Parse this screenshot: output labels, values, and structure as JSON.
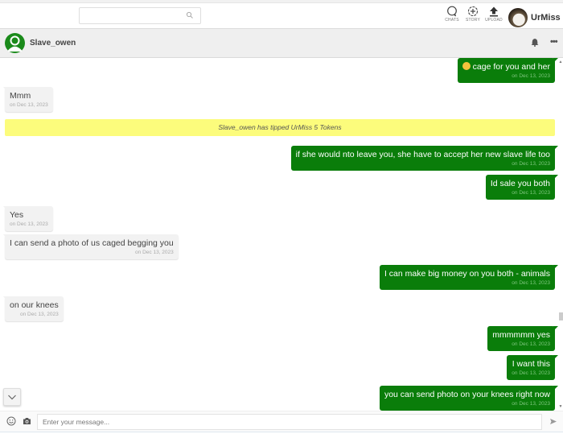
{
  "topbar": {
    "search": {
      "value": "",
      "placeholder": ""
    },
    "nav": [
      {
        "icon": "chat-bubble-icon",
        "label": "CHATS"
      },
      {
        "icon": "add-story-icon",
        "label": "STORY"
      },
      {
        "icon": "upload-icon",
        "label": "UPLOAD"
      }
    ],
    "user": {
      "name": "UrMiss",
      "caret": "▾"
    }
  },
  "chat_header": {
    "contact_name": "Slave_owen",
    "more_label": "•••"
  },
  "colors": {
    "outgoing_bubble": "#0a7d0a",
    "incoming_bubble": "#f2f2f2",
    "tip_banner": "#fcfc7c",
    "avatar_green": "#1a8a1a"
  },
  "messages": [
    {
      "direction": "out",
      "emoji": true,
      "text": "cage for you and her",
      "time": "on Dec 13, 2023"
    },
    {
      "direction": "in",
      "text": "Mmm",
      "time": "on Dec 13, 2023"
    },
    {
      "direction": "system",
      "text": "Slave_owen has tipped UrMiss 5 Tokens"
    },
    {
      "direction": "out",
      "text": "if she would nto leave you, she have to accept her new slave life too",
      "time": "on Dec 13, 2023"
    },
    {
      "direction": "out",
      "text": "Id sale you both",
      "time": "on Dec 13, 2023"
    },
    {
      "direction": "in",
      "text": "Yes",
      "time": "on Dec 13, 2023"
    },
    {
      "direction": "in",
      "text": "I can send a photo of us caged begging you",
      "time": "on Dec 13, 2023"
    },
    {
      "direction": "out",
      "text": "I can make big money on you both - animals",
      "time": "on Dec 13, 2023"
    },
    {
      "direction": "in",
      "text": "on our knees",
      "time": "on Dec 13, 2023"
    },
    {
      "direction": "out",
      "text": "mmmmmm yes",
      "time": "on Dec 13, 2023"
    },
    {
      "direction": "out",
      "text": "I want this",
      "time": "on Dec 13, 2023"
    },
    {
      "direction": "out",
      "text": "you can send photo on your knees right now",
      "time": "on Dec 13, 2023"
    }
  ],
  "composer": {
    "value": "",
    "placeholder": "Enter your message..."
  }
}
